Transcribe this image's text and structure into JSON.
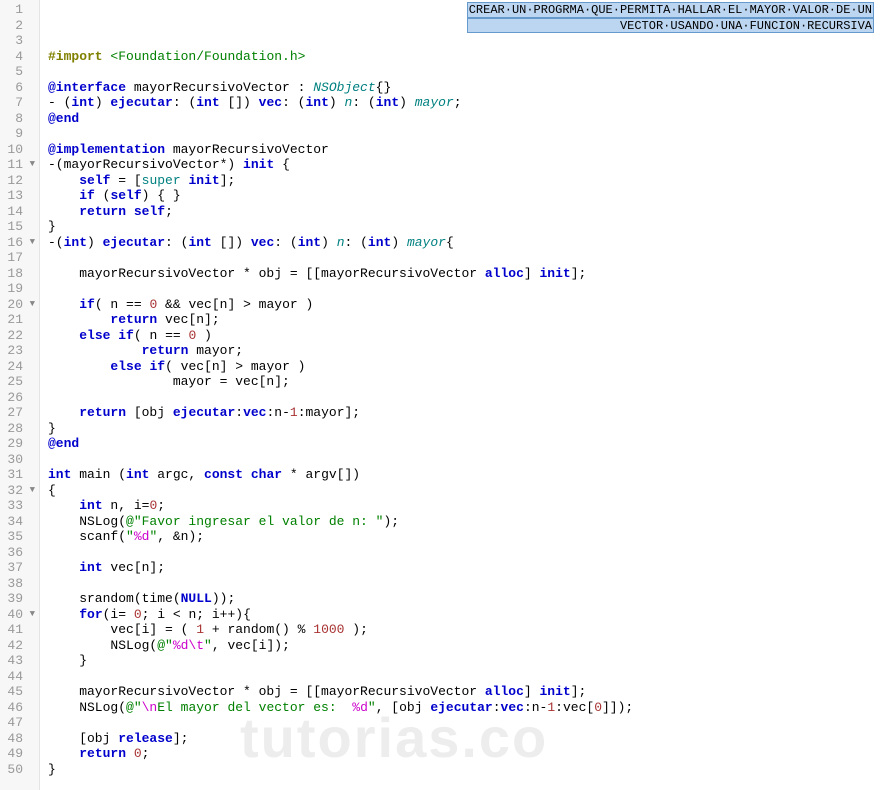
{
  "watermark": "tutorias.co",
  "comment": {
    "line1": "CREAR·UN·PROGRMA·QUE·PERMITA·HALLAR·EL·MAYOR·VALOR·DE·UN",
    "line2": "VECTOR·USANDO·UNA·FUNCION·RECURSIVA"
  },
  "lines": [
    {
      "n": 1,
      "fold": "",
      "tokens": []
    },
    {
      "n": 2,
      "fold": "",
      "tokens": []
    },
    {
      "n": 3,
      "fold": "",
      "tokens": []
    },
    {
      "n": 4,
      "fold": "",
      "tokens": [
        {
          "t": "#import ",
          "c": "dir"
        },
        {
          "t": "<Foundation/Foundation.h>",
          "c": "str"
        }
      ]
    },
    {
      "n": 5,
      "fold": "",
      "tokens": []
    },
    {
      "n": 6,
      "fold": "",
      "tokens": [
        {
          "t": "@interface",
          "c": "kw"
        },
        {
          "t": " mayorRecursivoVector : ",
          "c": ""
        },
        {
          "t": "NSObject",
          "c": "cls"
        },
        {
          "t": "{}",
          "c": ""
        }
      ]
    },
    {
      "n": 7,
      "fold": "",
      "tokens": [
        {
          "t": "- (",
          "c": ""
        },
        {
          "t": "int",
          "c": "kw"
        },
        {
          "t": ") ",
          "c": ""
        },
        {
          "t": "ejecutar",
          "c": "kw"
        },
        {
          "t": ": (",
          "c": ""
        },
        {
          "t": "int",
          "c": "kw"
        },
        {
          "t": " []) ",
          "c": ""
        },
        {
          "t": "vec",
          "c": "kw"
        },
        {
          "t": ": (",
          "c": ""
        },
        {
          "t": "int",
          "c": "kw"
        },
        {
          "t": ") ",
          "c": ""
        },
        {
          "t": "n",
          "c": "cls"
        },
        {
          "t": ": (",
          "c": ""
        },
        {
          "t": "int",
          "c": "kw"
        },
        {
          "t": ") ",
          "c": ""
        },
        {
          "t": "mayor",
          "c": "cls"
        },
        {
          "t": ";",
          "c": ""
        }
      ]
    },
    {
      "n": 8,
      "fold": "",
      "tokens": [
        {
          "t": "@end",
          "c": "kw"
        }
      ]
    },
    {
      "n": 9,
      "fold": "",
      "tokens": []
    },
    {
      "n": 10,
      "fold": "",
      "tokens": [
        {
          "t": "@implementation",
          "c": "kw"
        },
        {
          "t": " mayorRecursivoVector",
          "c": ""
        }
      ]
    },
    {
      "n": 11,
      "fold": "▼",
      "tokens": [
        {
          "t": "-(mayorRecursivoVector*) ",
          "c": ""
        },
        {
          "t": "init",
          "c": "kw"
        },
        {
          "t": " {",
          "c": ""
        }
      ]
    },
    {
      "n": 12,
      "fold": "",
      "tokens": [
        {
          "t": "    ",
          "c": ""
        },
        {
          "t": "self",
          "c": "kw"
        },
        {
          "t": " = [",
          "c": ""
        },
        {
          "t": "super",
          "c": "sup"
        },
        {
          "t": " ",
          "c": ""
        },
        {
          "t": "init",
          "c": "kw"
        },
        {
          "t": "];",
          "c": ""
        }
      ]
    },
    {
      "n": 13,
      "fold": "",
      "tokens": [
        {
          "t": "    ",
          "c": ""
        },
        {
          "t": "if",
          "c": "kw"
        },
        {
          "t": " (",
          "c": ""
        },
        {
          "t": "self",
          "c": "kw"
        },
        {
          "t": ") { }",
          "c": ""
        }
      ]
    },
    {
      "n": 14,
      "fold": "",
      "tokens": [
        {
          "t": "    ",
          "c": ""
        },
        {
          "t": "return",
          "c": "kw"
        },
        {
          "t": " ",
          "c": ""
        },
        {
          "t": "self",
          "c": "kw"
        },
        {
          "t": ";",
          "c": ""
        }
      ]
    },
    {
      "n": 15,
      "fold": "",
      "tokens": [
        {
          "t": "}",
          "c": ""
        }
      ]
    },
    {
      "n": 16,
      "fold": "▼",
      "tokens": [
        {
          "t": "-(",
          "c": ""
        },
        {
          "t": "int",
          "c": "kw"
        },
        {
          "t": ") ",
          "c": ""
        },
        {
          "t": "ejecutar",
          "c": "kw"
        },
        {
          "t": ": (",
          "c": ""
        },
        {
          "t": "int",
          "c": "kw"
        },
        {
          "t": " []) ",
          "c": ""
        },
        {
          "t": "vec",
          "c": "kw"
        },
        {
          "t": ": (",
          "c": ""
        },
        {
          "t": "int",
          "c": "kw"
        },
        {
          "t": ") ",
          "c": ""
        },
        {
          "t": "n",
          "c": "cls"
        },
        {
          "t": ": (",
          "c": ""
        },
        {
          "t": "int",
          "c": "kw"
        },
        {
          "t": ") ",
          "c": ""
        },
        {
          "t": "mayor",
          "c": "cls"
        },
        {
          "t": "{",
          "c": ""
        }
      ]
    },
    {
      "n": 17,
      "fold": "",
      "tokens": []
    },
    {
      "n": 18,
      "fold": "",
      "tokens": [
        {
          "t": "    mayorRecursivoVector * obj = [[mayorRecursivoVector ",
          "c": ""
        },
        {
          "t": "alloc",
          "c": "kw"
        },
        {
          "t": "] ",
          "c": ""
        },
        {
          "t": "init",
          "c": "kw"
        },
        {
          "t": "];",
          "c": ""
        }
      ]
    },
    {
      "n": 19,
      "fold": "",
      "tokens": []
    },
    {
      "n": 20,
      "fold": "▼",
      "tokens": [
        {
          "t": "    ",
          "c": ""
        },
        {
          "t": "if",
          "c": "kw"
        },
        {
          "t": "( n == ",
          "c": ""
        },
        {
          "t": "0",
          "c": "num"
        },
        {
          "t": " && vec[n] > mayor )",
          "c": ""
        }
      ]
    },
    {
      "n": 21,
      "fold": "",
      "tokens": [
        {
          "t": "        ",
          "c": ""
        },
        {
          "t": "return",
          "c": "kw"
        },
        {
          "t": " vec[n];",
          "c": ""
        }
      ]
    },
    {
      "n": 22,
      "fold": "",
      "tokens": [
        {
          "t": "    ",
          "c": ""
        },
        {
          "t": "else",
          "c": "kw"
        },
        {
          "t": " ",
          "c": ""
        },
        {
          "t": "if",
          "c": "kw"
        },
        {
          "t": "( n == ",
          "c": ""
        },
        {
          "t": "0",
          "c": "num"
        },
        {
          "t": " )",
          "c": ""
        }
      ]
    },
    {
      "n": 23,
      "fold": "",
      "tokens": [
        {
          "t": "            ",
          "c": ""
        },
        {
          "t": "return",
          "c": "kw"
        },
        {
          "t": " mayor;",
          "c": ""
        }
      ]
    },
    {
      "n": 24,
      "fold": "",
      "tokens": [
        {
          "t": "        ",
          "c": ""
        },
        {
          "t": "else",
          "c": "kw"
        },
        {
          "t": " ",
          "c": ""
        },
        {
          "t": "if",
          "c": "kw"
        },
        {
          "t": "( vec[n] > mayor )",
          "c": ""
        }
      ]
    },
    {
      "n": 25,
      "fold": "",
      "tokens": [
        {
          "t": "                mayor = vec[n];",
          "c": ""
        }
      ]
    },
    {
      "n": 26,
      "fold": "",
      "tokens": []
    },
    {
      "n": 27,
      "fold": "",
      "tokens": [
        {
          "t": "    ",
          "c": ""
        },
        {
          "t": "return",
          "c": "kw"
        },
        {
          "t": " [obj ",
          "c": ""
        },
        {
          "t": "ejecutar",
          "c": "kw"
        },
        {
          "t": ":",
          "c": ""
        },
        {
          "t": "vec",
          "c": "kw"
        },
        {
          "t": ":n-",
          "c": ""
        },
        {
          "t": "1",
          "c": "num"
        },
        {
          "t": ":mayor];",
          "c": ""
        }
      ]
    },
    {
      "n": 28,
      "fold": "",
      "tokens": [
        {
          "t": "}",
          "c": ""
        }
      ]
    },
    {
      "n": 29,
      "fold": "",
      "tokens": [
        {
          "t": "@end",
          "c": "kw"
        }
      ]
    },
    {
      "n": 30,
      "fold": "",
      "tokens": []
    },
    {
      "n": 31,
      "fold": "",
      "tokens": [
        {
          "t": "int",
          "c": "kw"
        },
        {
          "t": " main (",
          "c": ""
        },
        {
          "t": "int",
          "c": "kw"
        },
        {
          "t": " argc, ",
          "c": ""
        },
        {
          "t": "const",
          "c": "kw"
        },
        {
          "t": " ",
          "c": ""
        },
        {
          "t": "char",
          "c": "kw"
        },
        {
          "t": " * argv[])",
          "c": ""
        }
      ]
    },
    {
      "n": 32,
      "fold": "▼",
      "tokens": [
        {
          "t": "{",
          "c": ""
        }
      ]
    },
    {
      "n": 33,
      "fold": "",
      "tokens": [
        {
          "t": "    ",
          "c": ""
        },
        {
          "t": "int",
          "c": "kw"
        },
        {
          "t": " n, i=",
          "c": ""
        },
        {
          "t": "0",
          "c": "num"
        },
        {
          "t": ";",
          "c": ""
        }
      ]
    },
    {
      "n": 34,
      "fold": "",
      "tokens": [
        {
          "t": "    NSLog(",
          "c": ""
        },
        {
          "t": "@\"Favor ingresar el valor de n: \"",
          "c": "str"
        },
        {
          "t": ");",
          "c": ""
        }
      ]
    },
    {
      "n": 35,
      "fold": "",
      "tokens": [
        {
          "t": "    scanf(",
          "c": ""
        },
        {
          "t": "\"",
          "c": "str"
        },
        {
          "t": "%d",
          "c": "esc"
        },
        {
          "t": "\"",
          "c": "str"
        },
        {
          "t": ", &n);",
          "c": ""
        }
      ]
    },
    {
      "n": 36,
      "fold": "",
      "tokens": []
    },
    {
      "n": 37,
      "fold": "",
      "tokens": [
        {
          "t": "    ",
          "c": ""
        },
        {
          "t": "int",
          "c": "kw"
        },
        {
          "t": " vec[n];",
          "c": ""
        }
      ]
    },
    {
      "n": 38,
      "fold": "",
      "tokens": []
    },
    {
      "n": 39,
      "fold": "",
      "tokens": [
        {
          "t": "    srandom(time(",
          "c": ""
        },
        {
          "t": "NULL",
          "c": "kw"
        },
        {
          "t": "));",
          "c": ""
        }
      ]
    },
    {
      "n": 40,
      "fold": "▼",
      "tokens": [
        {
          "t": "    ",
          "c": ""
        },
        {
          "t": "for",
          "c": "kw"
        },
        {
          "t": "(i= ",
          "c": ""
        },
        {
          "t": "0",
          "c": "num"
        },
        {
          "t": "; i < n; i++){",
          "c": ""
        }
      ]
    },
    {
      "n": 41,
      "fold": "",
      "tokens": [
        {
          "t": "        vec[i] = ( ",
          "c": ""
        },
        {
          "t": "1",
          "c": "num"
        },
        {
          "t": " + random() % ",
          "c": ""
        },
        {
          "t": "1000",
          "c": "num"
        },
        {
          "t": " );",
          "c": ""
        }
      ]
    },
    {
      "n": 42,
      "fold": "",
      "tokens": [
        {
          "t": "        NSLog(",
          "c": ""
        },
        {
          "t": "@\"",
          "c": "str"
        },
        {
          "t": "%d\\t",
          "c": "esc"
        },
        {
          "t": "\"",
          "c": "str"
        },
        {
          "t": ", vec[i]);",
          "c": ""
        }
      ]
    },
    {
      "n": 43,
      "fold": "",
      "tokens": [
        {
          "t": "    }",
          "c": ""
        }
      ]
    },
    {
      "n": 44,
      "fold": "",
      "tokens": []
    },
    {
      "n": 45,
      "fold": "",
      "tokens": [
        {
          "t": "    mayorRecursivoVector * obj = [[mayorRecursivoVector ",
          "c": ""
        },
        {
          "t": "alloc",
          "c": "kw"
        },
        {
          "t": "] ",
          "c": ""
        },
        {
          "t": "init",
          "c": "kw"
        },
        {
          "t": "];",
          "c": ""
        }
      ]
    },
    {
      "n": 46,
      "fold": "",
      "tokens": [
        {
          "t": "    NSLog(",
          "c": ""
        },
        {
          "t": "@\"",
          "c": "str"
        },
        {
          "t": "\\n",
          "c": "esc"
        },
        {
          "t": "El mayor del vector es:  ",
          "c": "str"
        },
        {
          "t": "%d",
          "c": "esc"
        },
        {
          "t": "\"",
          "c": "str"
        },
        {
          "t": ", [obj ",
          "c": ""
        },
        {
          "t": "ejecutar",
          "c": "kw"
        },
        {
          "t": ":",
          "c": ""
        },
        {
          "t": "vec",
          "c": "kw"
        },
        {
          "t": ":n-",
          "c": ""
        },
        {
          "t": "1",
          "c": "num"
        },
        {
          "t": ":vec[",
          "c": ""
        },
        {
          "t": "0",
          "c": "num"
        },
        {
          "t": "]]);",
          "c": ""
        }
      ]
    },
    {
      "n": 47,
      "fold": "",
      "tokens": []
    },
    {
      "n": 48,
      "fold": "",
      "tokens": [
        {
          "t": "    [obj ",
          "c": ""
        },
        {
          "t": "release",
          "c": "kw"
        },
        {
          "t": "];",
          "c": ""
        }
      ]
    },
    {
      "n": 49,
      "fold": "",
      "tokens": [
        {
          "t": "    ",
          "c": ""
        },
        {
          "t": "return",
          "c": "kw"
        },
        {
          "t": " ",
          "c": ""
        },
        {
          "t": "0",
          "c": "num"
        },
        {
          "t": ";",
          "c": ""
        }
      ]
    },
    {
      "n": 50,
      "fold": "",
      "tokens": [
        {
          "t": "}",
          "c": ""
        }
      ]
    }
  ]
}
